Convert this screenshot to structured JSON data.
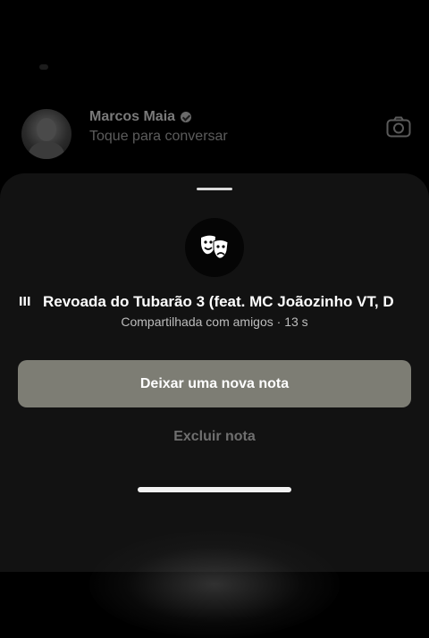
{
  "chat": {
    "contact_name": "Marcos Maia",
    "subtitle": "Toque para conversar"
  },
  "note_sheet": {
    "song_title": "Revoada do Tubarão 3 (feat. MC Joãozinho VT, D",
    "shared_info": "Compartilhada com amigos · 13 s",
    "primary_button": "Deixar uma nova nota",
    "delete_button": "Excluir nota"
  },
  "icons": {
    "note": "theater-masks-icon",
    "camera": "camera-icon",
    "music": "music-bars-icon",
    "verified": "verified-badge-icon"
  },
  "colors": {
    "background": "#000000",
    "sheet": "#121212",
    "primary_button": "#7d7d74"
  }
}
